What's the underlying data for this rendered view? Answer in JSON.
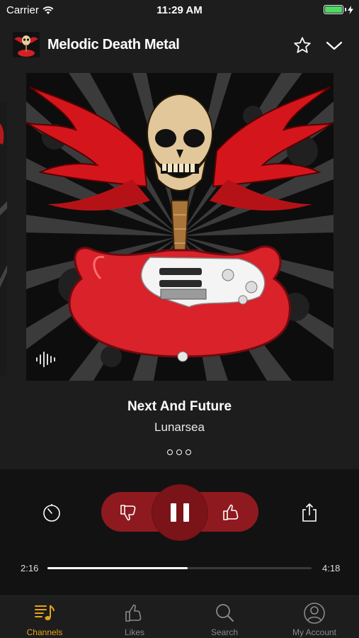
{
  "status_bar": {
    "carrier": "Carrier",
    "time": "11:29 AM"
  },
  "header": {
    "channel_title": "Melodic Death Metal"
  },
  "now_playing": {
    "title": "Next And Future",
    "artist": "Lunarsea"
  },
  "progress": {
    "elapsed": "2:16",
    "duration": "4:18",
    "fraction": 0.53
  },
  "tabs": [
    {
      "label": "Channels",
      "icon": "music-note-list-icon",
      "active": true
    },
    {
      "label": "Likes",
      "icon": "thumb-up-icon",
      "active": false
    },
    {
      "label": "Search",
      "icon": "search-icon",
      "active": false
    },
    {
      "label": "My Account",
      "icon": "user-icon",
      "active": false
    }
  ],
  "colors": {
    "accent": "#e6a21b",
    "control_red": "#8e1a1f",
    "play_red": "#7b1418",
    "battery_green": "#4cd964"
  }
}
